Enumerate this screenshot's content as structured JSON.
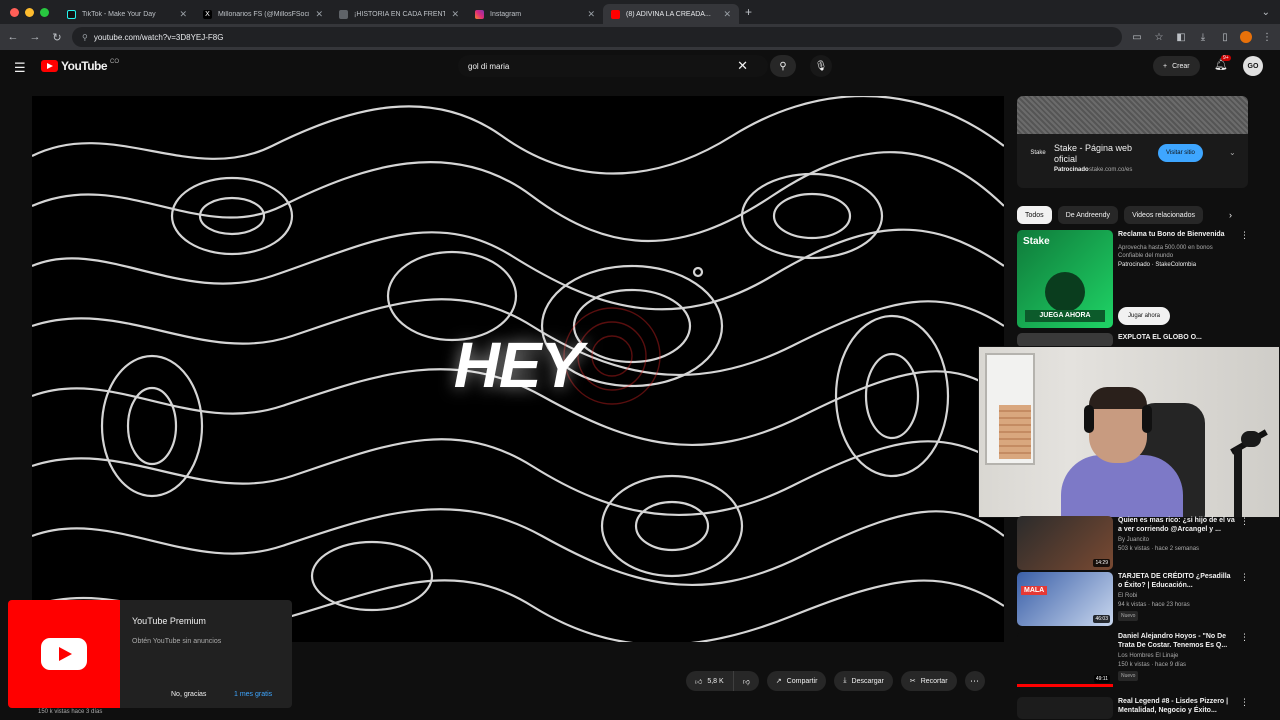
{
  "browser": {
    "tabs": [
      {
        "title": "TikTok - Make Your Day",
        "fav": "#111111",
        "active": false
      },
      {
        "title": "Millonarios FS (@MillosFSoci...",
        "fav": "#000000",
        "active": false
      },
      {
        "title": "¡HISTORIA EN CADA FRENTE!",
        "fav": "#3c4043",
        "active": false
      },
      {
        "title": "Instagram",
        "fav": "#d6249f",
        "active": false
      },
      {
        "title": "(8) ADIVINA LA CREADA...",
        "fav": "#ff0000",
        "active": true
      }
    ],
    "url": "youtube.com/watch?v=3D8YEJ-F8G",
    "new_tab": "+"
  },
  "masthead": {
    "logo_text": "YouTube",
    "logo_sup": "CO",
    "search_value": "gol di maria",
    "create_label": "Crear",
    "notif_count": "9+",
    "avatar_initials": "GO"
  },
  "player": {
    "overlay_text": "HEY"
  },
  "below_player": {
    "views": "150 k vistas hace 3 días",
    "likes": "5,8 K",
    "share": "Compartir",
    "download": "Descargar",
    "clip": "Recortar"
  },
  "toast": {
    "title": "YouTube Premium",
    "subtitle": "Obtén YouTube sin anuncios",
    "dismiss": "No, gracias",
    "cta": "1 mes gratis"
  },
  "ad": {
    "logo": "Stake",
    "title": "Stake - Página web oficial",
    "sponsor": "Patrocinado",
    "url": "stake.com.co/es",
    "cta": "Visitar sitio"
  },
  "chips": [
    "Todos",
    "De Andreendy",
    "Videos relacionados"
  ],
  "recs": [
    {
      "title": "Reclama tu Bono de Bienvenida",
      "meta1": "Aprovecha hasta 500.000 en bonos",
      "meta2": "Confiable del mundo",
      "meta3": "Patrocinado · StakeColombia",
      "dur": ""
    },
    {
      "title": "EXPLOTA EL GLOBO O...",
      "meta1": "",
      "meta2": "",
      "meta3": "",
      "dur": ""
    },
    {
      "title": "Quien es mas rico: ¿si hijo de el va a ver corriendo @Arcangel y ...",
      "meta1": "By Juancito",
      "meta2": "503 k vistas · hace 2 semanas",
      "meta3": "",
      "dur": "14:29"
    },
    {
      "title": "TARJETA DE CRÉDITO ¿Pesadilla o Éxito? | Educación...",
      "meta1": "El Robi",
      "meta2": "94 k vistas · hace 23 horas",
      "meta3": "Nuevo",
      "dur": "46:03"
    },
    {
      "title": "Daniel Alejandro Hoyos - \"No De Trata De Costar. Tenemos Es Q...",
      "meta1": "Los Hombres El Linaje",
      "meta2": "150 k vistas · hace 9 días",
      "meta3": "Nuevo",
      "dur": "49:11"
    },
    {
      "title": "Real Legend #8 - Lisdes Pizzero | Mentalidad, Negocio y Éxito...",
      "meta1": "",
      "meta2": "",
      "meta3": "",
      "dur": ""
    }
  ],
  "ad_play_label": "Jugar ahora",
  "thumb_text": {
    "brand": "Stake",
    "cta": "JUEGA AHORA",
    "red_tag": "MALA"
  }
}
